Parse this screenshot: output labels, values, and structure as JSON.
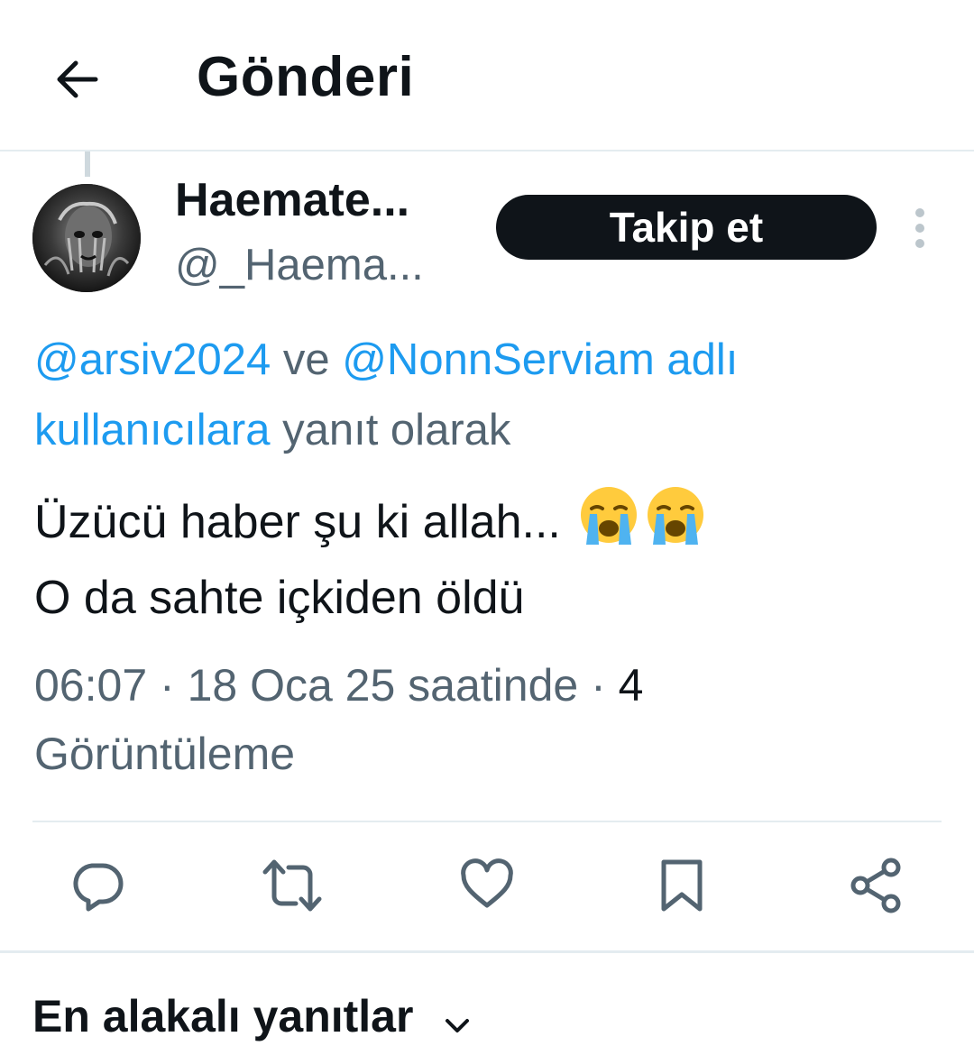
{
  "header": {
    "title": "Gönderi"
  },
  "author": {
    "display_name": "Haemate...",
    "handle": "@_Haema...",
    "follow_label": "Takip et"
  },
  "reply_context": {
    "mention_1": "@arsiv2024",
    "connector": " ve ",
    "mention_2": "@NonnServiam",
    "suffix_link": " adlı kullanıcılara",
    "suffix_text": " yanıt olarak"
  },
  "tweet": {
    "line1": "Üzücü haber şu ki allah...",
    "line2": "O da sahte içkiden öldü",
    "emojis": [
      "loudly-crying-face",
      "loudly-crying-face"
    ]
  },
  "meta": {
    "time": "06:07",
    "separator": " · ",
    "date": "18 Oca 25 saatinde",
    "views_count": "4",
    "views_label": "Görüntüleme"
  },
  "actions": [
    "reply",
    "repost",
    "like",
    "bookmark",
    "share"
  ],
  "replies_sort": {
    "label": "En alakalı yanıtlar"
  },
  "colors": {
    "link": "#1d9bf0",
    "muted": "#536471",
    "text": "#0f1419",
    "divider": "#e4ecf0"
  }
}
